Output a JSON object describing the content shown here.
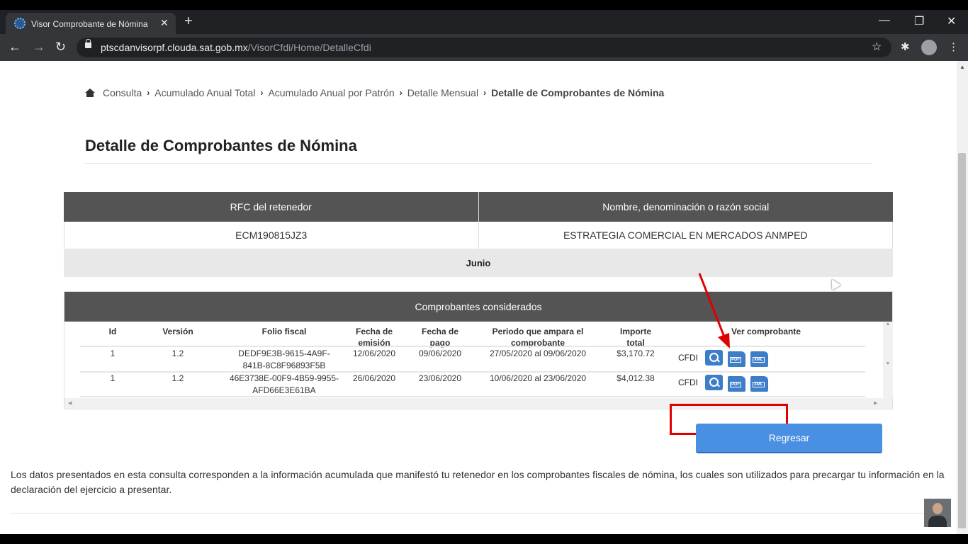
{
  "browser": {
    "tab_title": "Visor Comprobante de Nómina",
    "url_host": "ptscdanvisorpf.clouda.sat.gob.mx",
    "url_path": "/VisorCfdi/Home/DetalleCfdi"
  },
  "breadcrumb": {
    "items": [
      "Consulta",
      "Acumulado Anual Total",
      "Acumulado Anual por Patrón",
      "Detalle Mensual"
    ],
    "current": "Detalle de Comprobantes de Nómina"
  },
  "page_title": "Detalle de Comprobantes de Nómina",
  "retenedor": {
    "col_rfc": "RFC del retenedor",
    "col_nombre": "Nombre, denominación o razón social",
    "rfc": "ECM190815JZ3",
    "nombre": "ESTRATEGIA COMERCIAL EN MERCADOS ANMPED",
    "mes": "Junio"
  },
  "comprobantes": {
    "caption": "Comprobantes considerados",
    "headers": {
      "id": "Id",
      "version": "Versión",
      "folio": "Folio fiscal",
      "fecha_emision_1": "Fecha de",
      "fecha_emision_2": "emisión",
      "fecha_pago_1": "Fecha de",
      "fecha_pago_2": "pago",
      "periodo_1": "Periodo que ampara el",
      "periodo_2": "comprobante",
      "importe_1": "Importe",
      "importe_2": "total",
      "ver": "Ver comprobante"
    },
    "rows": [
      {
        "id": "1",
        "version": "1.2",
        "folio_1": "DEDF9E3B-9615-4A9F-",
        "folio_2": "841B-8C8F96893F5B",
        "fecha_emision": "12/06/2020",
        "fecha_pago": "09/06/2020",
        "periodo": "27/05/2020 al 09/06/2020",
        "importe": "$3,170.72",
        "cfdi": "CFDI"
      },
      {
        "id": "1",
        "version": "1.2",
        "folio_1": "46E3738E-00F9-4B59-9955-",
        "folio_2": "AFD66E3E61BA",
        "fecha_emision": "26/06/2020",
        "fecha_pago": "23/06/2020",
        "periodo": "10/06/2020 al 23/06/2020",
        "importe": "$4,012.38",
        "cfdi": "CFDI"
      }
    ],
    "pdf_label": "PDF",
    "xml_label": "XML"
  },
  "regresar_label": "Regresar",
  "footnote": "Los datos presentados en esta consulta corresponden a la información acumulada que manifestó tu retenedor en los comprobantes fiscales de nómina, los cuales son utilizados para precargar tu información en la declaración del ejercicio a presentar.",
  "colors": {
    "header_bg": "#545454",
    "button_blue": "#4a90e2",
    "highlight_red": "#e00000"
  }
}
